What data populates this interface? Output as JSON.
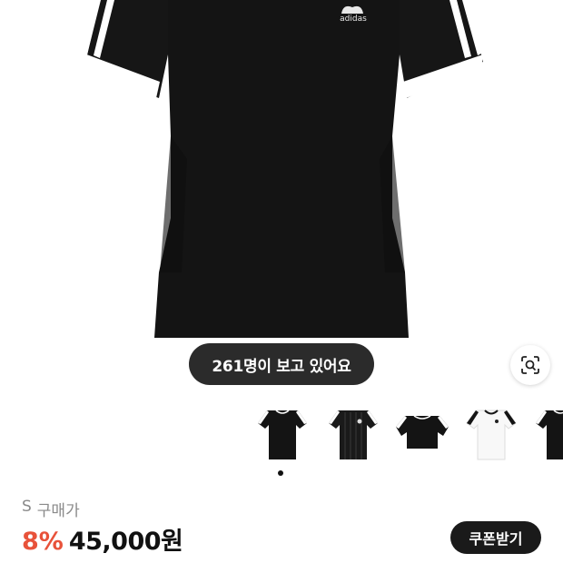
{
  "hero": {
    "brand_text": "adidas"
  },
  "viewers": {
    "text": "261명이 보고 있어요"
  },
  "lens": {
    "icon": "image-search-icon"
  },
  "thumbnails": [
    {
      "variant": "black-3-stripes-tee",
      "selected": true
    },
    {
      "variant": "black-striped-jersey",
      "selected": false
    },
    {
      "variant": "black-crop-tee",
      "selected": false
    },
    {
      "variant": "white-ringer-tee",
      "selected": false
    },
    {
      "variant": "black-tee-partial",
      "selected": false
    }
  ],
  "price": {
    "size_label": "S",
    "label": "구매가",
    "discount": "8%",
    "amount": "45,000원"
  },
  "coupon": {
    "label": "쿠폰받기"
  },
  "colors": {
    "discount": "#e8523a",
    "pill_bg": "#2b2b2b",
    "button_bg": "#1a1a1a"
  }
}
